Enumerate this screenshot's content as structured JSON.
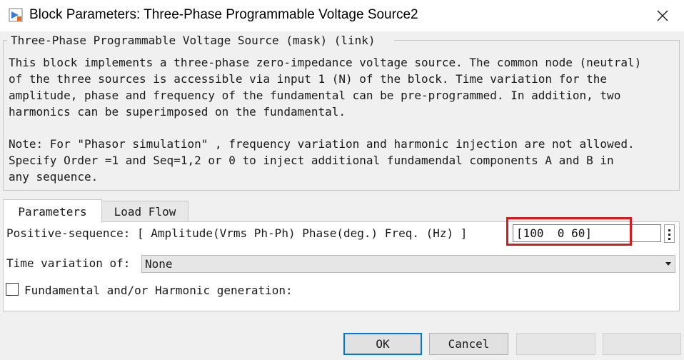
{
  "window": {
    "title": "Block Parameters: Three-Phase Programmable Voltage Source2"
  },
  "mask": {
    "group_title": "Three-Phase Programmable Voltage Source (mask) (link)",
    "description_lines": [
      "This block implements a three-phase zero-impedance voltage source. The common node (neutral)",
      "of the three sources is accessible via input 1 (N) of the block. Time variation for the",
      "amplitude, phase and frequency of the fundamental can be pre-programmed. In addition, two",
      "harmonics can be superimposed on the fundamental."
    ],
    "note_lines": [
      "Note: For  \"Phasor simulation\" , frequency variation and harmonic injection are not allowed.",
      "Specify  Order =1 and Seq=1,2 or 0 to inject additional fundamendal components A and B in",
      "any sequence."
    ]
  },
  "tabs": [
    {
      "label": "Parameters",
      "active": true
    },
    {
      "label": "Load Flow",
      "active": false
    }
  ],
  "parameters": {
    "positive_sequence_label": "Positive-sequence: [ Amplitude(Vrms Ph-Ph)  Phase(deg.)   Freq. (Hz) ]",
    "positive_sequence_value": "[100  0 60]",
    "time_variation_label": "Time variation of:",
    "time_variation_value": "None",
    "harmonic_generation_label": "Fundamental and/or Harmonic generation:",
    "harmonic_generation_checked": false
  },
  "buttons": {
    "ok": "OK",
    "cancel": "Cancel",
    "help": "",
    "apply": ""
  },
  "colors": {
    "highlight": "#d9191d",
    "focus": "#0078d7"
  }
}
